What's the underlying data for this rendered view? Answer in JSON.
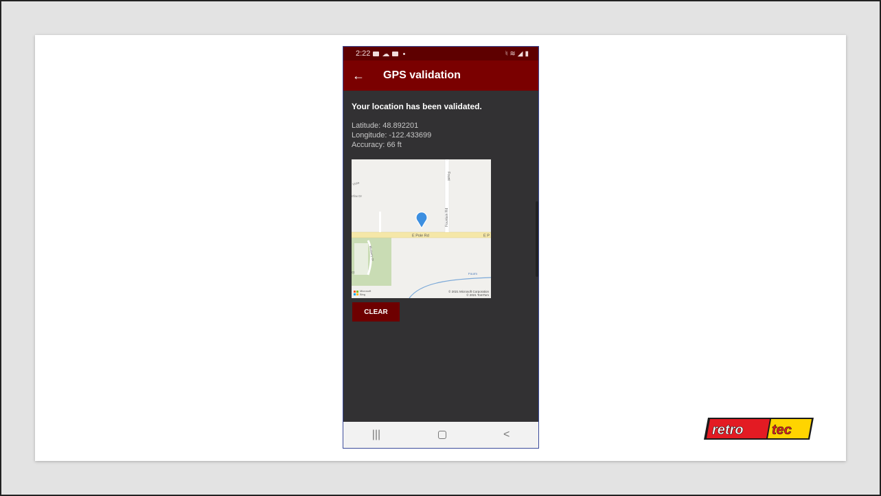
{
  "status_bar": {
    "time": "2:22"
  },
  "app_bar": {
    "back_icon": "arrow-left-icon",
    "title": "GPS validation"
  },
  "content": {
    "validated_text": "Your location has been validated.",
    "latitude": "Latitude: 48.892201",
    "longitude": "Longitude: -122.433699",
    "accuracy": "Accuracy: 66 ft"
  },
  "map": {
    "road_main": "E Pole Rd",
    "road_main_right": "E P",
    "road_vertical": "Fountain Rd",
    "road_top_right": "Fount",
    "label_vista": "Vista",
    "label_dr": "rrfax Dr",
    "label_blueberry": "Blueberry Dr",
    "label_ct": "Ct",
    "label_stream": "Fourm",
    "copyright_1": "© 2021 Microsoft Corporation",
    "copyright_2": "© 2021 TomTom",
    "ms_logo_text_1": "Microsoft",
    "ms_logo_text_2": "Bing",
    "pin_color": "#3d8fe0"
  },
  "actions": {
    "clear_label": "CLEAR"
  },
  "nav_bar": {
    "recents": "|||",
    "back": "<"
  },
  "logo": {
    "text": "retrotec",
    "primary": "#e31b23",
    "secondary": "#ffd400"
  }
}
